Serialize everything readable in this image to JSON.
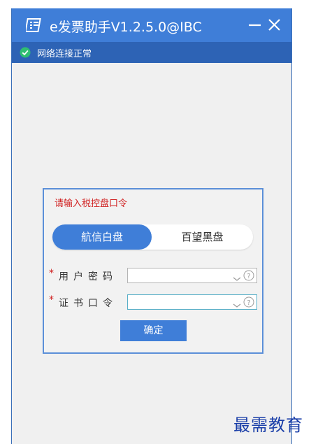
{
  "app": {
    "title": "e发票助手V1.2.5.0@IBC",
    "icon": "invoice-app-icon",
    "accent_color": "#3f7ed8",
    "status_bar_color": "#2d63b5"
  },
  "window_controls": {
    "minimize_icon": "minimize-icon",
    "close_icon": "close-icon"
  },
  "status": {
    "text": "网络连接正常",
    "icon": "check-circle-icon",
    "color": "#2fbf71"
  },
  "dialog": {
    "title": "请输入税控盘口令",
    "title_color": "#d02020",
    "toggle": {
      "options": [
        "航信白盘",
        "百望黑盘"
      ],
      "selected": "航信白盘"
    },
    "fields": [
      {
        "required_mark": "*",
        "label": "用户密码",
        "value": "",
        "dropdown_icon": "chevron-down-icon",
        "help_icon": "question-circle-icon"
      },
      {
        "required_mark": "*",
        "label": "证书口令",
        "value": "",
        "dropdown_icon": "chevron-down-icon",
        "help_icon": "question-circle-icon"
      }
    ],
    "confirm_label": "确定"
  },
  "watermark": {
    "text": "最需教育"
  }
}
